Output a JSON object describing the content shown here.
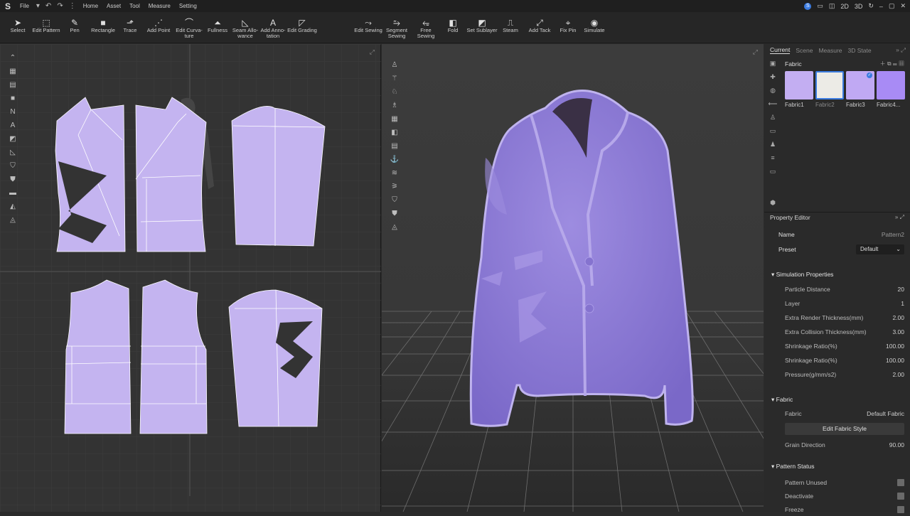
{
  "menubar": {
    "logo": "S",
    "file": "File",
    "items": [
      "Home",
      "Asset",
      "Tool",
      "Measure",
      "Setting"
    ],
    "views": [
      "2D",
      "3D"
    ]
  },
  "toolbar": [
    {
      "label": "Select",
      "icon": "select-arrow-icon"
    },
    {
      "label": "Edit Pattern",
      "icon": "edit-pattern-icon"
    },
    {
      "label": "Pen",
      "icon": "pen-icon"
    },
    {
      "label": "Rectangle",
      "icon": "rectangle-icon"
    },
    {
      "label": "Trace",
      "icon": "trace-icon"
    },
    {
      "label": "Add Point",
      "icon": "add-point-icon"
    },
    {
      "label": "Edit Curva- ture",
      "icon": "edit-curvature-icon"
    },
    {
      "label": "Fullness",
      "icon": "fullness-icon"
    },
    {
      "label": "Seam Allo- wance",
      "icon": "seam-allowance-icon"
    },
    {
      "label": "Add Anno- tation",
      "icon": "annotation-icon"
    },
    {
      "label": "Edit Grading",
      "icon": "grading-icon"
    },
    {
      "label": "Edit Sewing",
      "icon": "edit-sewing-icon"
    },
    {
      "label": "Segment Sewing",
      "icon": "segment-sewing-icon"
    },
    {
      "label": "Free Sewing",
      "icon": "free-sewing-icon"
    },
    {
      "label": "Fold",
      "icon": "fold-icon"
    },
    {
      "label": "Set Sublayer",
      "icon": "sublayer-icon"
    },
    {
      "label": "Steam",
      "icon": "steam-icon"
    },
    {
      "label": "Add Tack",
      "icon": "tack-icon"
    },
    {
      "label": "Fix Pin",
      "icon": "pin-icon"
    },
    {
      "label": "Simulate",
      "icon": "simulate-icon"
    }
  ],
  "library": {
    "tabs": [
      "Current",
      "Scene",
      "Measure",
      "3D State"
    ],
    "section": "Fabric",
    "fabrics": [
      {
        "label": "Fabric1",
        "color": "#c3aef2"
      },
      {
        "label": "Fabric2",
        "color": "#ecebe6"
      },
      {
        "label": "Fabric3",
        "color": "#c0a9f3"
      },
      {
        "label": "Fabric4...",
        "color": "#a88bf5"
      }
    ]
  },
  "property_editor": {
    "title": "Property Editor",
    "name_label": "Name",
    "name_value": "Pattern2",
    "preset_label": "Preset",
    "preset_value": "Default",
    "simulation_title": "Simulation Properties",
    "simulation": [
      {
        "k": "Particle Distance",
        "v": "20"
      },
      {
        "k": "Layer",
        "v": "1"
      },
      {
        "k": "Extra Render Thickness(mm)",
        "v": "2.00"
      },
      {
        "k": "Extra Collision Thickness(mm)",
        "v": "3.00"
      },
      {
        "k": "Shrinkage Ratio(%)",
        "v": "100.00"
      },
      {
        "k": "Shrinkage Ratio(%)",
        "v": "100.00"
      },
      {
        "k": "Pressure(g/mm/s2)",
        "v": "2.00"
      }
    ],
    "fabric_title": "Fabric",
    "fabric_label": "Fabric",
    "fabric_value": "Default Fabric",
    "edit_button": "Edit  Fabric Style",
    "grain_label": "Grain Direction",
    "grain_value": "90.00",
    "status_title": "Pattern Status",
    "status": [
      "Pattern Unused",
      "Deactivate",
      "Freeze"
    ]
  },
  "colors": {
    "pattern_fill": "#c4b4f0",
    "coat": "#8a78d6",
    "accent": "#3b7be0"
  }
}
